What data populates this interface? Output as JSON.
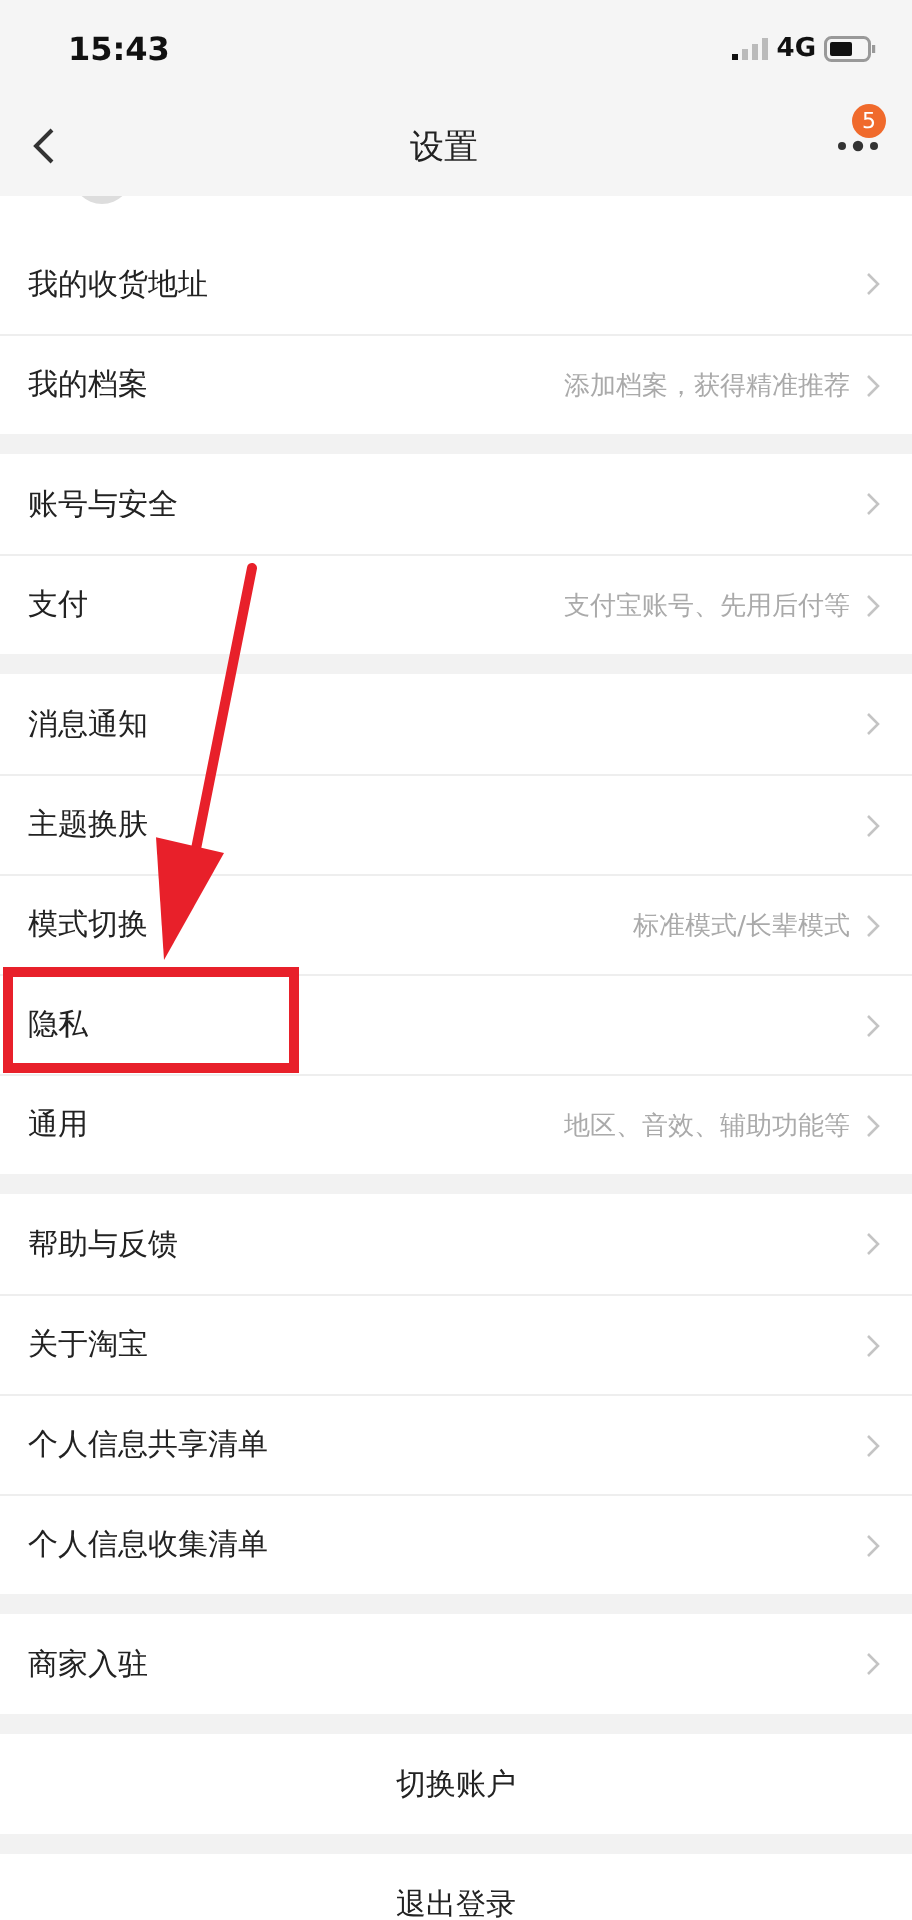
{
  "status_bar": {
    "time": "15:43",
    "network": "4G"
  },
  "nav": {
    "title": "设置",
    "badge": "5"
  },
  "groups": [
    {
      "items": [
        {
          "label": "我的收货地址"
        },
        {
          "label": "我的档案",
          "hint": "添加档案，获得精准推荐"
        }
      ]
    },
    {
      "items": [
        {
          "label": "账号与安全"
        },
        {
          "label": "支付",
          "hint": "支付宝账号、先用后付等"
        }
      ]
    },
    {
      "items": [
        {
          "label": "消息通知"
        },
        {
          "label": "主题换肤"
        },
        {
          "label": "模式切换",
          "hint": "标准模式/长辈模式"
        },
        {
          "label": "隐私"
        },
        {
          "label": "通用",
          "hint": "地区、音效、辅助功能等"
        }
      ]
    },
    {
      "items": [
        {
          "label": "帮助与反馈"
        },
        {
          "label": "关于淘宝"
        },
        {
          "label": "个人信息共享清单"
        },
        {
          "label": "个人信息收集清单"
        }
      ]
    },
    {
      "items": [
        {
          "label": "商家入驻"
        }
      ]
    }
  ],
  "actions": [
    {
      "label": "切换账户"
    },
    {
      "label": "退出登录"
    }
  ],
  "annotations": [
    {
      "kind": "arrow"
    },
    {
      "kind": "box"
    }
  ]
}
